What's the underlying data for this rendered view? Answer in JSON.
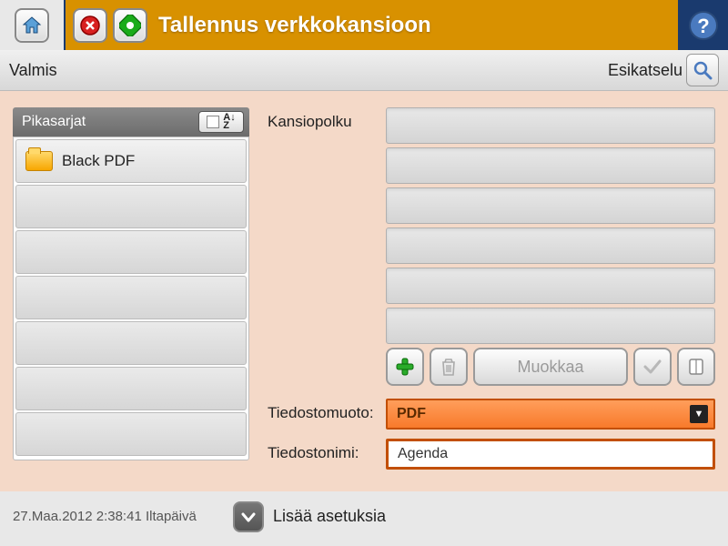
{
  "header": {
    "title": "Tallennus verkkokansioon"
  },
  "status": {
    "text": "Valmis",
    "preview_label": "Esikatselu"
  },
  "quicksets": {
    "header": "Pikasarjat",
    "sort_label": "A↓\nZ",
    "items": [
      "Black PDF",
      "",
      "",
      "",
      "",
      "",
      ""
    ]
  },
  "folder": {
    "path_label": "Kansiopolku",
    "paths": [
      "",
      "",
      "",
      "",
      "",
      ""
    ],
    "edit_label": "Muokkaa"
  },
  "file": {
    "format_label": "Tiedostomuoto:",
    "format_value": "PDF",
    "name_label": "Tiedostonimi:",
    "name_value": "Agenda"
  },
  "footer": {
    "timestamp": "27.Maa.2012 2:38:41 Iltapäivä",
    "more_label": "Lisää asetuksia"
  }
}
